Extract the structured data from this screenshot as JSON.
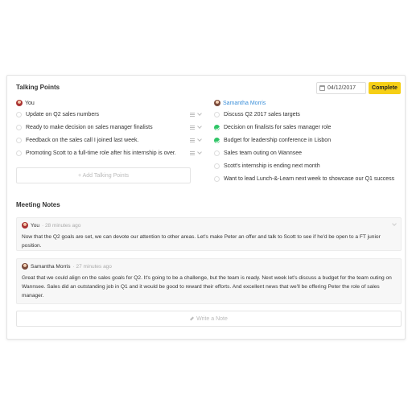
{
  "talking_points": {
    "title": "Talking Points",
    "date": "04/12/2017",
    "complete_label": "Complete",
    "left": {
      "name": "You",
      "items": [
        {
          "text": "Update on Q2 sales numbers",
          "done": false
        },
        {
          "text": "Ready to make decision on sales manager finalists",
          "done": false
        },
        {
          "text": "Feedback on the sales call I joined last week.",
          "done": false
        },
        {
          "text": "Promoting Scott to a full-time role after his internship is over.",
          "done": false
        }
      ]
    },
    "right": {
      "name": "Samantha Morris",
      "items": [
        {
          "text": "Discuss Q2 2017 sales targets",
          "done": false
        },
        {
          "text": "Decision on finalists for sales manager role",
          "done": true
        },
        {
          "text": "Budget for leadership conference in Lisbon",
          "done": true
        },
        {
          "text": "Sales team outing on Wannsee",
          "done": false
        },
        {
          "text": "Scott's internship is ending next month",
          "done": false
        },
        {
          "text": "Want to lead Lunch-&-Learn next week to showcase our Q1 success",
          "done": false
        }
      ]
    },
    "add_label": "+ Add Talking Points"
  },
  "meeting_notes": {
    "title": "Meeting Notes",
    "notes": [
      {
        "author": "You",
        "time": "· 28 minutes ago",
        "body": "Now that the Q2 goals are set, we can devote our attention to other areas. Let's make Peter an offer and talk to Scott to see if he'd be open to a FT junior position."
      },
      {
        "author": "Samantha Morris",
        "time": "· 27 minutes ago",
        "body": "Great that we could align on the sales goals for Q2. It's going to be a challenge, but the team is ready. Next week let's discuss a budget for the team outing on Wannsee. Sales did an outstanding job in Q1 and it would be good to reward their efforts. And excellent news that we'll be offering Peter the role of sales manager."
      }
    ],
    "write_placeholder": "Write a Note"
  },
  "colors": {
    "accent_yellow": "#f6cf16",
    "link_blue": "#3b8fd9",
    "done_green": "#2ec566"
  }
}
